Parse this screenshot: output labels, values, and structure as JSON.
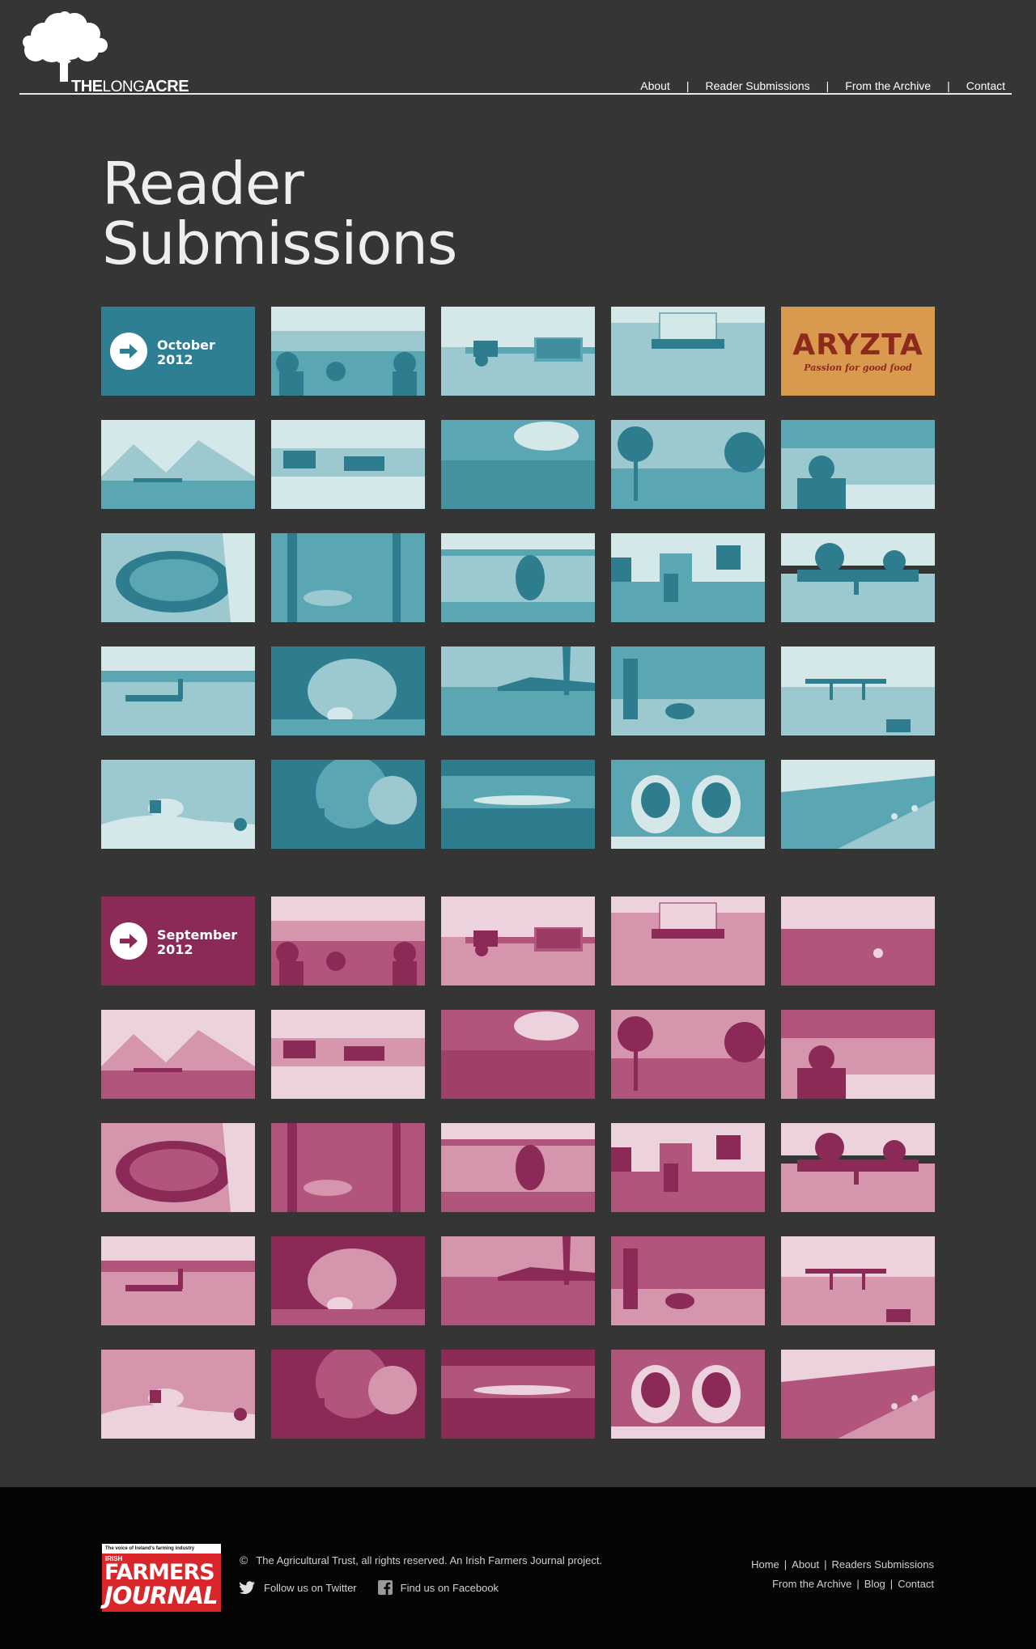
{
  "logo": {
    "text_bold": "THE",
    "text_light": "LONG",
    "text_bold2": "ACRE"
  },
  "nav": [
    "About",
    "Reader Submissions",
    "From the Archive",
    "Contact"
  ],
  "page_title": "Reader Submissions",
  "months": [
    {
      "name": "October",
      "year": "2012",
      "color": "#2e7f93"
    },
    {
      "name": "September",
      "year": "2012",
      "color": "#8b2957"
    }
  ],
  "sponsor": {
    "brand": "ARYZTA",
    "tagline": "Passion for good food"
  },
  "footer": {
    "logo_top": "The voice of Ireland's farming industry",
    "logo_irish": "IRISH",
    "logo_farmers": "FARMERS",
    "logo_journal": "JOURNAL",
    "copyright": "The Agricultural Trust, all rights reserved. An Irish Farmers Journal project.",
    "twitter": "Follow us on Twitter",
    "facebook": "Find us on Facebook",
    "links_row1": [
      "Home",
      "About",
      "Readers Submissions"
    ],
    "links_row2": [
      "From the Archive",
      "Blog",
      "Contact"
    ]
  }
}
